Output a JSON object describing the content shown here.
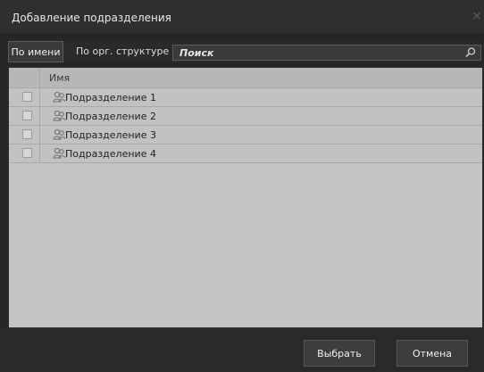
{
  "dialog": {
    "title": "Добавление подразделения",
    "close_glyph": "×"
  },
  "tabs": [
    {
      "label": "По имени",
      "active": true
    },
    {
      "label": "По орг. структуре",
      "active": false
    }
  ],
  "search": {
    "placeholder": "Поиск",
    "value": "",
    "icon": "search-icon"
  },
  "table": {
    "columns": [
      "",
      "Имя"
    ],
    "rows": [
      {
        "name": "Подразделение 1",
        "checked": false,
        "icon": "department-icon"
      },
      {
        "name": "Подразделение 2",
        "checked": false,
        "icon": "department-icon"
      },
      {
        "name": "Подразделение 3",
        "checked": false,
        "icon": "department-icon"
      },
      {
        "name": "Подразделение 4",
        "checked": false,
        "icon": "department-icon"
      }
    ]
  },
  "buttons": {
    "select_label": "Выбрать",
    "cancel_label": "Отмена"
  }
}
